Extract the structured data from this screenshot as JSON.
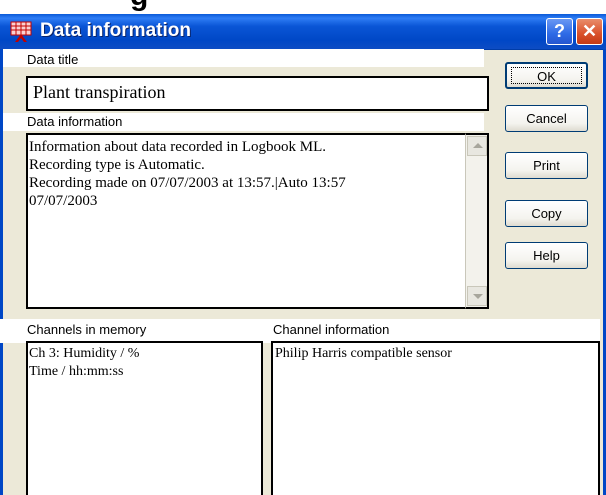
{
  "window": {
    "title": "Data information",
    "partial_header_text": "g",
    "help_glyph": "?",
    "close_glyph": "✕",
    "app_icon": "chart-icon"
  },
  "fields": {
    "data_title_label": "Data title",
    "data_title_value": "Plant transpiration",
    "data_info_label": "Data information",
    "data_info_value": "Information about data recorded in Logbook ML.\nRecording type is Automatic.\nRecording made on 07/07/2003 at 13:57.|Auto 13:57\n07/07/2003",
    "channels_label": "Channels in memory",
    "channels": [
      "Ch 3: Humidity / %",
      "Time / hh:mm:ss"
    ],
    "channel_info_label": "Channel information",
    "channel_info_value": "Philip Harris compatible sensor"
  },
  "buttons": {
    "ok": "OK",
    "cancel": "Cancel",
    "print": "Print",
    "copy": "Copy",
    "help": "Help"
  },
  "colors": {
    "titlebar": "#0047c6",
    "dialog_bg": "#ece9d8",
    "button_border": "#003c74"
  }
}
